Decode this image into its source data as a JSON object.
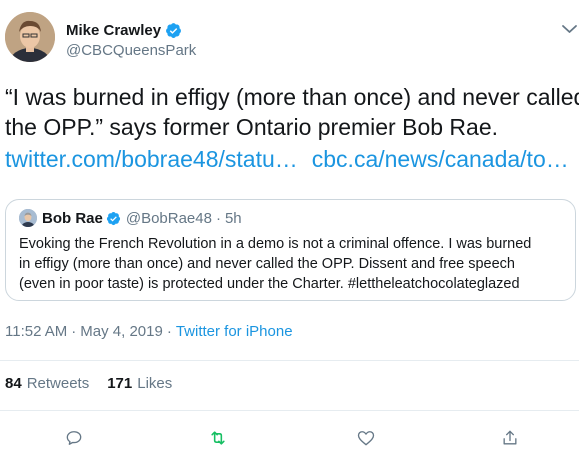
{
  "author": {
    "display_name": "Mike Crawley",
    "handle": "@CBCQueensPark"
  },
  "tweet": {
    "text_lines": [
      "“I was burned in effigy (more than once) and never called",
      "the OPP.” says former Ontario premier Bob Rae."
    ],
    "links": [
      "twitter.com/bobrae48/statu…",
      "cbc.ca/news/canada/to…"
    ]
  },
  "quoted": {
    "display_name": "Bob Rae",
    "handle": "@BobRae48",
    "separator": "·",
    "time": "5h",
    "text_lines": [
      "Evoking the French Revolution in a demo is not a criminal offence.  I was burned",
      "in effigy (more than once) and never called the OPP.  Dissent and free speech",
      "(even in poor taste) is protected under the Charter.  #lettheleatchocolateglazed"
    ]
  },
  "meta": {
    "time": "11:52 AM",
    "separator": "·",
    "date": "May 4, 2019",
    "source": "Twitter for iPhone"
  },
  "stats": {
    "retweets_count": "84",
    "retweets_label": "Retweets",
    "likes_count": "171",
    "likes_label": "Likes"
  },
  "colors": {
    "link": "#1b95e0",
    "verified": "#1da1f2",
    "retweet_icon": "#17bf63",
    "secondary_text": "#657786"
  },
  "icons": {
    "verified": "verified-badge-icon",
    "more": "chevron-down-icon",
    "reply": "reply-icon",
    "retweet": "retweet-icon",
    "like": "heart-icon",
    "share": "share-icon"
  }
}
